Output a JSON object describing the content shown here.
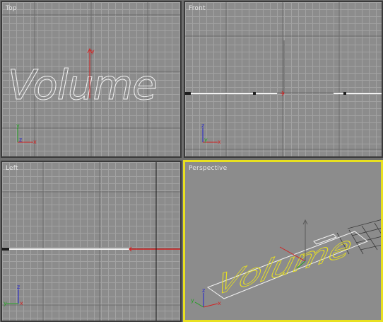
{
  "viewports": {
    "top": {
      "label": "Top"
    },
    "front": {
      "label": "Front"
    },
    "left": {
      "label": "Left"
    },
    "perspective": {
      "label": "Perspective"
    }
  },
  "scene": {
    "text_object": "Volume"
  },
  "axes": {
    "x": "x",
    "y": "y",
    "z": "z"
  },
  "colors": {
    "viewport_bg": "#8c8c8c",
    "grid_line": "#a2a2a2",
    "grid_major": "#5a5a5a",
    "active_border": "#e8e020",
    "gizmo_x": "#d42020",
    "gizmo_y": "#1fa01f",
    "gizmo_z": "#2020d0",
    "text_outline": "#ffffff",
    "text_selected": "#e8e020"
  }
}
